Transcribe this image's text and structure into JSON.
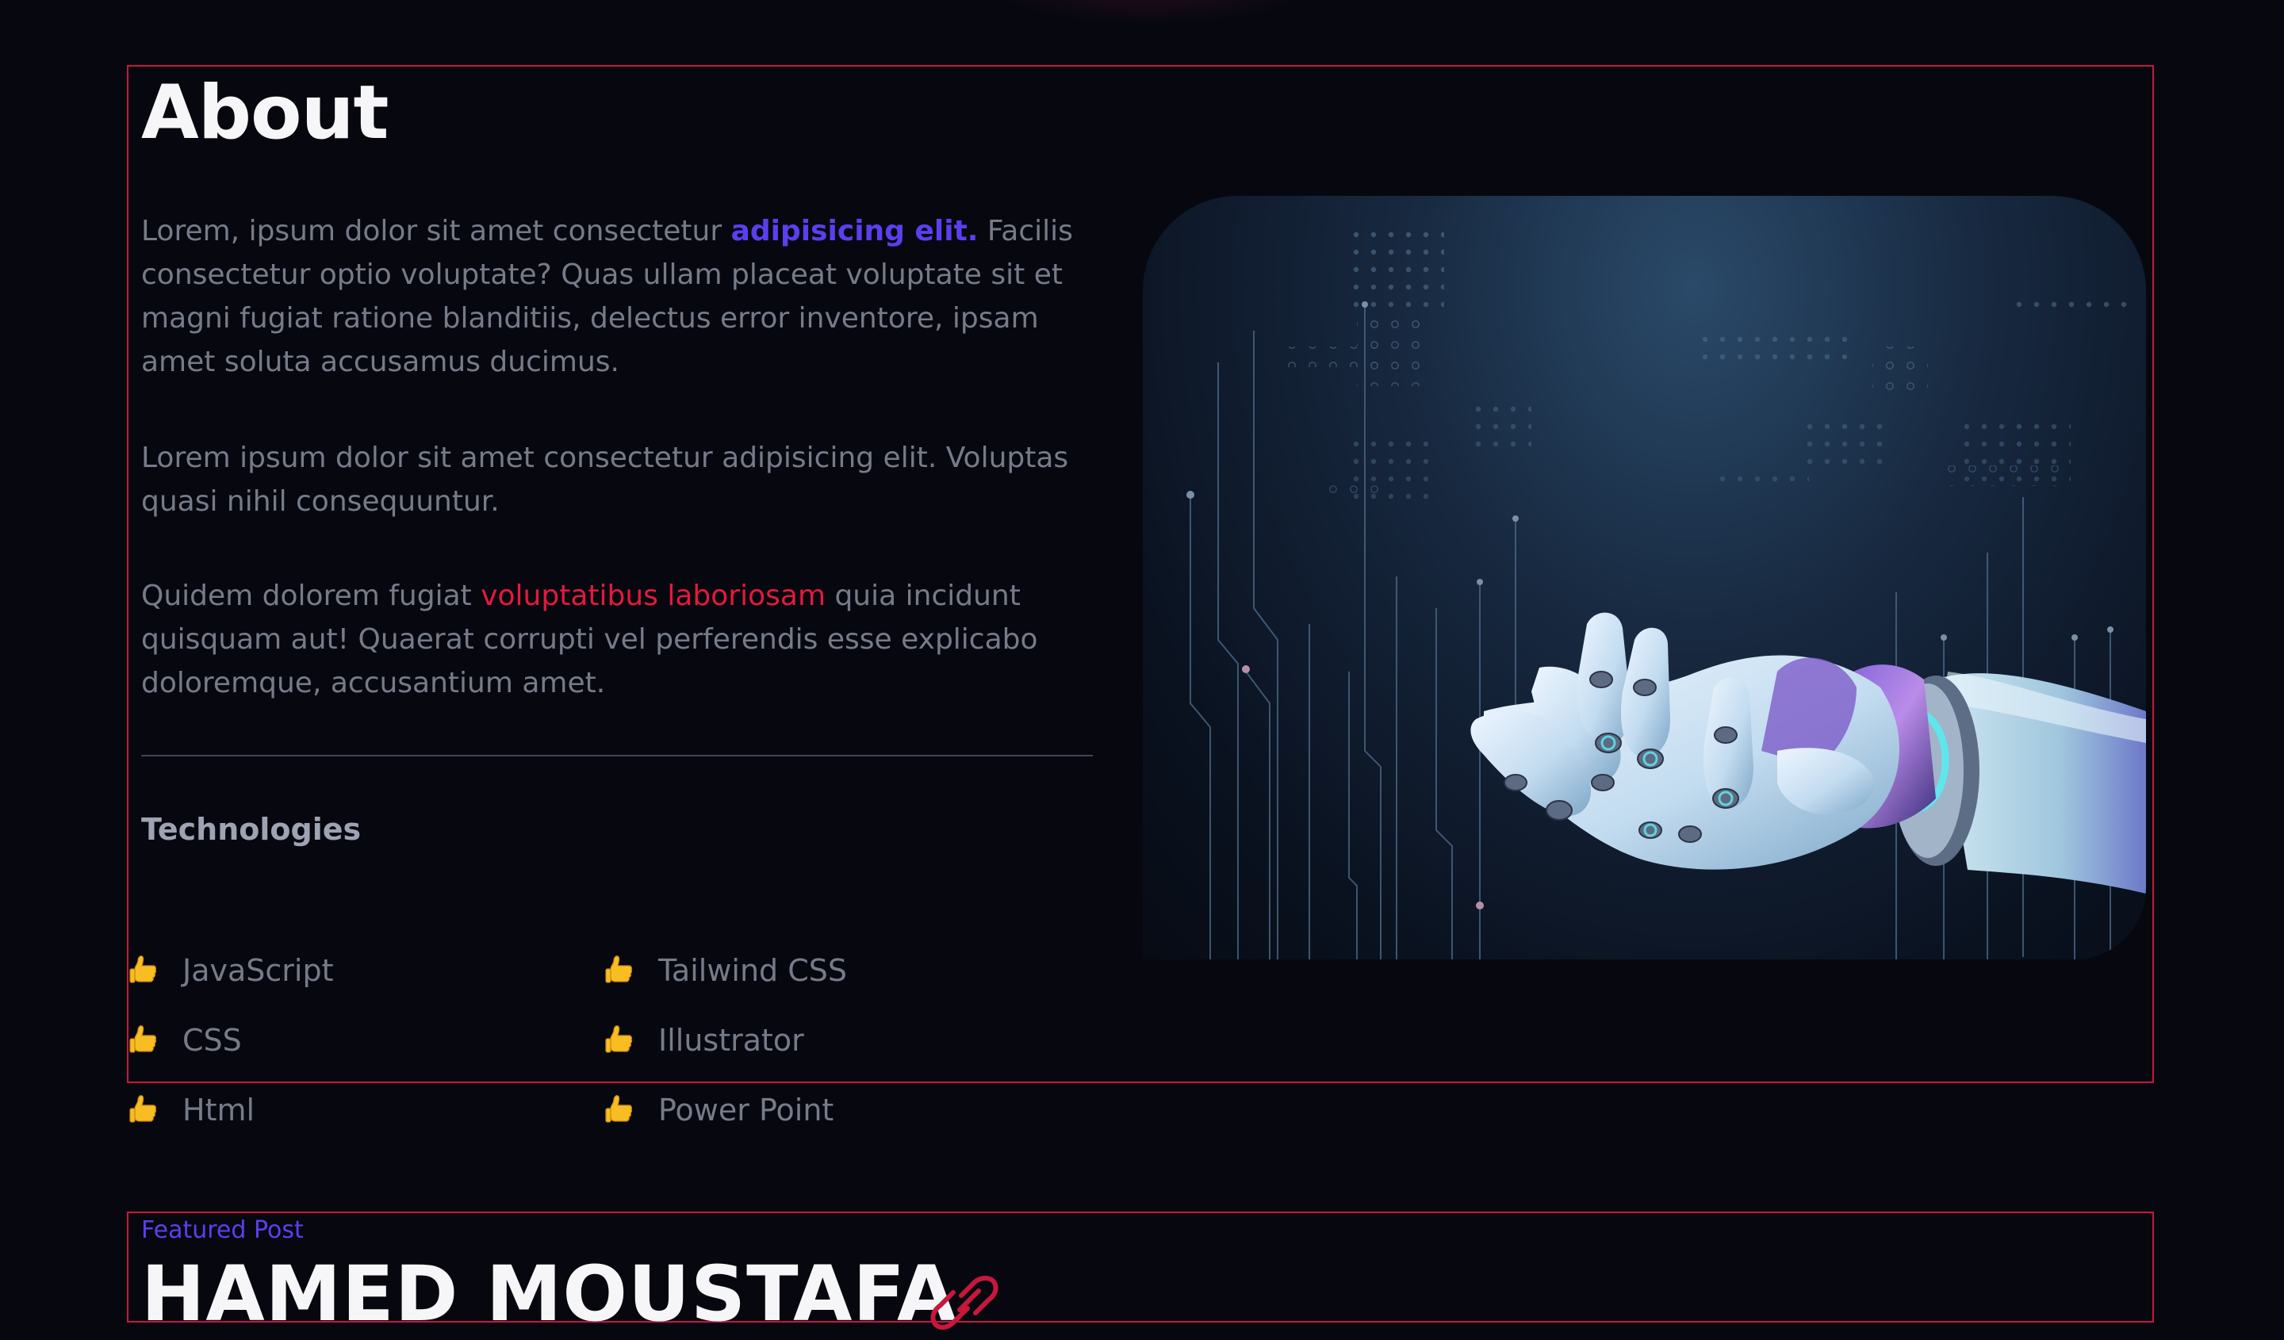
{
  "about": {
    "title": "About",
    "paragraph1": {
      "before": "Lorem, ipsum dolor sit amet consectetur ",
      "highlight": "adipisicing elit.",
      "after": " Facilis consectetur optio voluptate? Quas ullam placeat voluptate sit et magni fugiat ratione blanditiis, delectus error inventore, ipsam amet soluta accusamus ducimus."
    },
    "paragraph2": "Lorem ipsum dolor sit amet consectetur adipisicing elit. Voluptas quasi nihil consequuntur.",
    "paragraph3": {
      "before": "Quidem dolorem fugiat ",
      "highlight": "voluptatibus laboriosam",
      "after": " quia incidunt quisquam aut! Quaerat corrupti vel perferendis esse explicabo doloremque, accusantium amet."
    },
    "technologies_heading": "Technologies",
    "technologies": [
      "JavaScript",
      "Tailwind CSS",
      "CSS",
      "Illustrator",
      "Html",
      "Power Point"
    ],
    "technology_icon": "thumbs-up-icon",
    "image_subject": "robot-hand-image"
  },
  "featured": {
    "label": "Featured Post",
    "title": "HAMED MOUSTAFA",
    "icon": "link-icon"
  },
  "colors": {
    "background": "#07080f",
    "section_border": "#c8173d",
    "heading": "#f6f6f8",
    "body_text": "#767b89",
    "accent_blue": "#5a3ff0",
    "accent_red": "#e5183e"
  }
}
